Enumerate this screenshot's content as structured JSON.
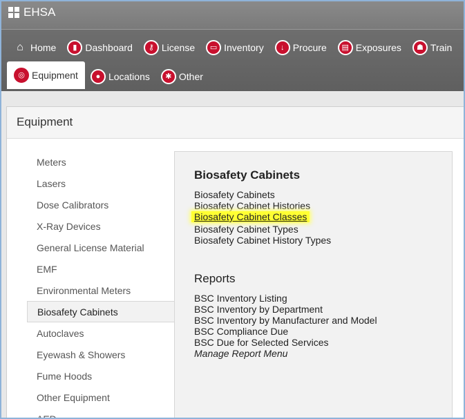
{
  "app": {
    "title": "EHSA"
  },
  "nav": {
    "row1": [
      {
        "label": "Home",
        "icon": "home-icon"
      },
      {
        "label": "Dashboard",
        "icon": "bar-chart-icon"
      },
      {
        "label": "License",
        "icon": "key-icon"
      },
      {
        "label": "Inventory",
        "icon": "truck-icon"
      },
      {
        "label": "Procure",
        "icon": "download-arrow-icon"
      },
      {
        "label": "Exposures",
        "icon": "clipboard-icon"
      },
      {
        "label": "Train",
        "icon": "training-icon"
      }
    ],
    "row2": [
      {
        "label": "Equipment",
        "icon": "gauge-icon",
        "active": true
      },
      {
        "label": "Locations",
        "icon": "map-pin-icon"
      },
      {
        "label": "Other",
        "icon": "asterisk-icon"
      }
    ]
  },
  "panel": {
    "title": "Equipment",
    "sidebar": [
      "Meters",
      "Lasers",
      "Dose Calibrators",
      "X-Ray Devices",
      "General License Material",
      "EMF",
      "Environmental Meters",
      "Biosafety Cabinets",
      "Autoclaves",
      "Eyewash & Showers",
      "Fume Hoods",
      "Other Equipment",
      "AED"
    ],
    "active_sidebar": "Biosafety Cabinets",
    "section1": {
      "title": "Biosafety Cabinets",
      "links": [
        "Biosafety Cabinets",
        "Biosafety Cabinet Histories",
        "Biosafety Cabinet Classes",
        "Biosafety Cabinet Types",
        "Biosafety Cabinet History Types"
      ]
    },
    "section2": {
      "title": "Reports",
      "links": [
        "BSC Inventory Listing",
        "BSC Inventory by Department",
        "BSC Inventory by Manufacturer and Model",
        "BSC Compliance Due",
        "BSC Due for Selected Services",
        "Manage Report Menu"
      ]
    }
  },
  "colors": {
    "accent": "#c8102e",
    "highlight": "#ffff33"
  }
}
